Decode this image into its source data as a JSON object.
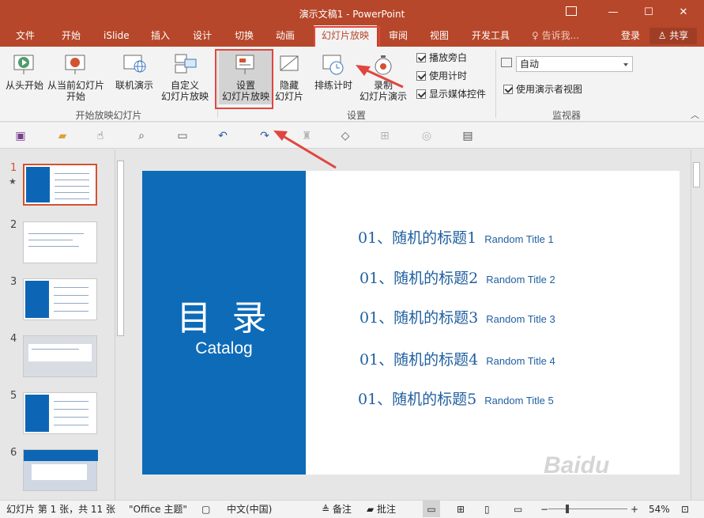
{
  "window": {
    "title": "演示文稿1 - PowerPoint"
  },
  "tabs": [
    {
      "label": "文件"
    },
    {
      "label": "开始"
    },
    {
      "label": "iSlide"
    },
    {
      "label": "插入"
    },
    {
      "label": "设计"
    },
    {
      "label": "切换"
    },
    {
      "label": "动画"
    },
    {
      "label": "幻灯片放映"
    },
    {
      "label": "审阅"
    },
    {
      "label": "视图"
    },
    {
      "label": "开发工具"
    }
  ],
  "tell_me": "告诉我...",
  "login": "登录",
  "share": "共享",
  "ribbon": {
    "groups": {
      "start": "开始放映幻灯片",
      "setup": "设置",
      "monitor": "监视器"
    },
    "buttons": {
      "from_beginning": "从头开始",
      "from_current_line1": "从当前幻灯片",
      "from_current_line2": "开始",
      "online_line1": "联机演示",
      "custom_line1": "自定义",
      "custom_line2": "幻灯片放映",
      "setup_line1": "设置",
      "setup_line2": "幻灯片放映",
      "hide_line1": "隐藏",
      "hide_line2": "幻灯片",
      "rehearse": "排练计时",
      "record_line1": "录制",
      "record_line2": "幻灯片演示"
    },
    "checkboxes": {
      "narration": "播放旁白",
      "timings": "使用计时",
      "media": "显示媒体控件",
      "presenter": "使用演示者视图"
    },
    "monitor_select": "自动"
  },
  "thumbnails": [
    "1",
    "2",
    "3",
    "4",
    "5",
    "6"
  ],
  "slide": {
    "title": "目 录",
    "subtitle": "Catalog",
    "items": [
      {
        "cn": "01、随机的标题1",
        "en": "Random Title 1"
      },
      {
        "cn": "01、随机的标题2",
        "en": "Random Title 2"
      },
      {
        "cn": "01、随机的标题3",
        "en": "Random Title 3"
      },
      {
        "cn": "01、随机的标题4",
        "en": "Random Title 4"
      },
      {
        "cn": "01、随机的标题5",
        "en": "Random Title 5"
      }
    ]
  },
  "status": {
    "slide_info": "幻灯片 第 1 张，共 11 张",
    "theme": "\"Office 主题\"",
    "language": "中文(中国)",
    "notes": "备注",
    "comments": "批注",
    "zoom": "54%"
  },
  "colors": {
    "accent": "#b7472a",
    "slide_blue": "#0d6bb7",
    "highlight": "#e0463e"
  }
}
